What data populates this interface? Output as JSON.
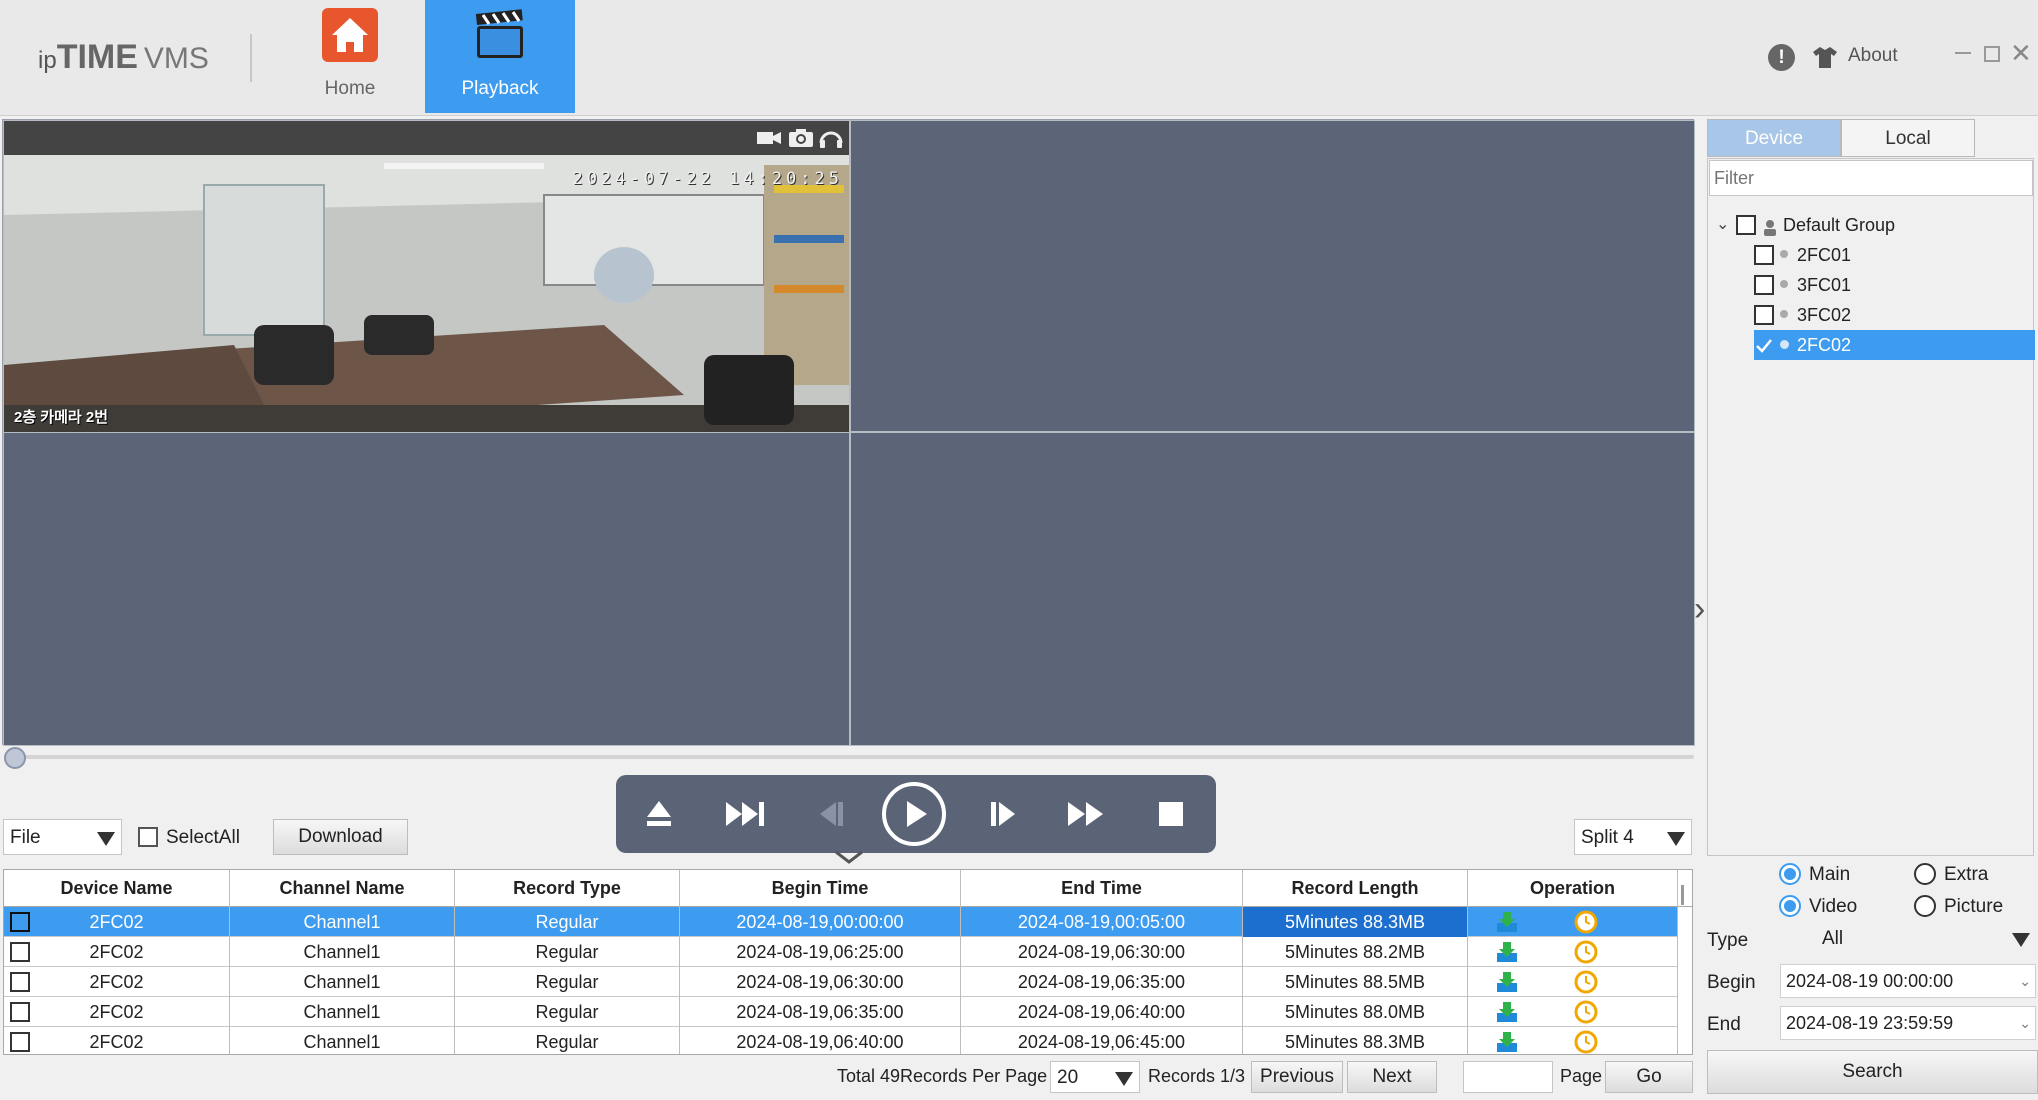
{
  "app": {
    "logo_ip": "ip",
    "logo_time": "TIME",
    "logo_vms": "VMS",
    "nav": [
      {
        "label": "Home",
        "active": false
      },
      {
        "label": "Playback",
        "active": true
      }
    ],
    "about_label": "About",
    "colors": {
      "accent": "#3d9bf0",
      "home_icon": "#e8562d",
      "video_bg": "#5c6577",
      "controls_bg": "#5b6376"
    }
  },
  "video": {
    "camera_timestamp": "2024-07-22 14:20:25",
    "camera_label": "2층 카메라 2번",
    "toolbar_icons": [
      "record-icon",
      "snapshot-icon",
      "audio-icon"
    ]
  },
  "filters": {
    "file_select": "File",
    "select_all": "SelectAll",
    "download": "Download",
    "split_select": "Split 4"
  },
  "table": {
    "columns": [
      "Device Name",
      "Channel Name",
      "Record Type",
      "Begin Time",
      "End Time",
      "Record Length",
      "Operation"
    ],
    "rows": [
      {
        "device": "2FC02",
        "channel": "Channel1",
        "type": "Regular",
        "begin": "2024-08-19,00:00:00",
        "end": "2024-08-19,00:05:00",
        "length": "5Minutes 88.3MB"
      },
      {
        "device": "2FC02",
        "channel": "Channel1",
        "type": "Regular",
        "begin": "2024-08-19,06:25:00",
        "end": "2024-08-19,06:30:00",
        "length": "5Minutes 88.2MB"
      },
      {
        "device": "2FC02",
        "channel": "Channel1",
        "type": "Regular",
        "begin": "2024-08-19,06:30:00",
        "end": "2024-08-19,06:35:00",
        "length": "5Minutes 88.5MB"
      },
      {
        "device": "2FC02",
        "channel": "Channel1",
        "type": "Regular",
        "begin": "2024-08-19,06:35:00",
        "end": "2024-08-19,06:40:00",
        "length": "5Minutes 88.0MB"
      },
      {
        "device": "2FC02",
        "channel": "Channel1",
        "type": "Regular",
        "begin": "2024-08-19,06:40:00",
        "end": "2024-08-19,06:45:00",
        "length": "5Minutes 88.3MB"
      }
    ]
  },
  "pagination": {
    "total": "Total 49Records Per Page",
    "per_page": "20",
    "records": "Records 1/3",
    "previous": "Previous",
    "next": "Next",
    "page_label": "Page",
    "go": "Go"
  },
  "sidebar": {
    "tabs": [
      "Device",
      "Local"
    ],
    "filter_placeholder": "Filter",
    "group": "Default Group",
    "devices": [
      "2FC01",
      "3FC01",
      "3FC02",
      "2FC02"
    ],
    "selected_device": "2FC02",
    "stream_main": "Main",
    "stream_extra": "Extra",
    "media_video": "Video",
    "media_picture": "Picture",
    "type_label": "Type",
    "type_value": "All",
    "begin_label": "Begin",
    "begin_value": "2024-08-19 00:00:00",
    "end_label": "End",
    "end_value": "2024-08-19 23:59:59",
    "search": "Search"
  }
}
